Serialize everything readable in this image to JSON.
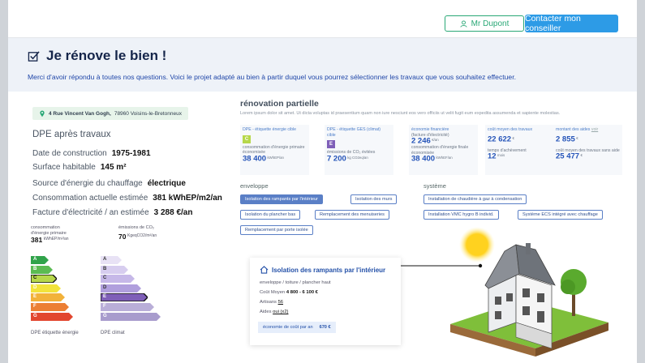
{
  "header": {
    "user_label": "Mr Dupont",
    "contact_label": "Contacter mon conseiller"
  },
  "banner": {
    "title": "Je rénove le bien !",
    "subtitle": "Merci d'avoir répondu à toutes nos questions. Voici le projet adapté au bien à partir duquel vous pourrez sélectionner les travaux que vous souhaitez effectuer."
  },
  "address": {
    "street": "4 Rue Vincent Van Gogh,",
    "city": "78960 Voisins-le-Bretonneux"
  },
  "dpe": {
    "title": "DPE après travaux",
    "construction_label": "Date de construction",
    "construction_value": "1975-1981",
    "surface_label": "Surface habitable",
    "surface_value": "145 m²",
    "energy_source_label": "Source d'énergie du chauffage",
    "energy_source_value": "électrique",
    "consumption_label": "Consommation actuelle estimée",
    "consumption_value": "381 kWhEP/m2/an",
    "bill_label": "Facture d'électricité / an estimée",
    "bill_value": "3 288 €/an",
    "primary_label_1": "consommation",
    "primary_label_2": "d'énergie primaire",
    "primary_value": "381",
    "primary_unit": "kWhEP/m²/an",
    "co2_label": "émissions de CO₂",
    "co2_value": "70",
    "co2_unit": "KgeqCO2/m²/an",
    "energy_scale_label": "DPE étiquette énergie",
    "climate_scale_label": "DPE climat",
    "energy_letters": [
      "A",
      "B",
      "C",
      "D",
      "E",
      "F",
      "G"
    ],
    "climate_letters": [
      "A",
      "B",
      "C",
      "D",
      "E",
      "F",
      "G"
    ],
    "energy_selected": "C",
    "climate_selected": "E",
    "colors": {
      "energy": [
        "#30a34a",
        "#5bbb52",
        "#b6d74a",
        "#f2e33b",
        "#f2b23a",
        "#ec7f34",
        "#e2462f"
      ],
      "climate": [
        "#e8e2f5",
        "#d7cdef",
        "#c6b8e8",
        "#b09fdd",
        "#7f5fb8",
        "#b9aed8",
        "#a89ccd"
      ]
    }
  },
  "renovation": {
    "title": "rénovation partielle",
    "subtitle": "Lorem ipsum dolor sit amet. Ut dicta voluptas id praesentium quam non iure nesciunt eos vero officiis ut velit fugit eum expedita assumenda et sapiente molestias.",
    "cards": [
      {
        "label": "DPE - étiquette énergie cible",
        "badge": "C",
        "badge_color": "#b6d74a",
        "line1": "consommation d'énergie primaire",
        "line2": "économisée",
        "value": "38 400",
        "unit": "kWhEP/an"
      },
      {
        "label": "DPE - étiquette GES (climat)",
        "label2": "cible",
        "badge": "E",
        "badge_color": "#7f5fb8",
        "line1": "émissions de CO₂ évitées",
        "value": "7 200",
        "unit": "kg CO2eq/an"
      },
      {
        "label": "économie financière",
        "label2": "(facture d'électricité)",
        "value_top": "2 246",
        "unit_top": "€/an",
        "line1": "consommation d'énergie finale",
        "line2": "économisée",
        "value": "38 400",
        "unit": "kWhEF/an"
      },
      {
        "label": "coût moyen des travaux",
        "value_top": "22 622",
        "unit_top": "€",
        "line1": "temps d'achèvement",
        "value": "12",
        "unit": "mois"
      },
      {
        "label": "montant des aides",
        "label_link": "voir",
        "value_top": "2 855",
        "unit_top": "€",
        "line1": "coût moyen des travaux sans aide",
        "value": "25 477",
        "unit": "€"
      }
    ],
    "envelope_label": "enveloppe",
    "system_label": "système",
    "envelope_tags": [
      "Isolation des rampants par l'intérieur",
      "Isolation des murs",
      "Isolation du plancher bas",
      "Remplacement des menuiseries",
      "Remplacement par porte isolée"
    ],
    "system_tags": [
      "Installation de chaudière à gaz à condensation",
      "Installation VMC hygro B individ.",
      "Système ECS intégré avec chauffage"
    ]
  },
  "detail": {
    "title": "Isolation des rampants par l'intérieur",
    "path": "enveloppe / toiture / plancher haut",
    "cost_label": "Coût Moyen",
    "cost_value": "4 800 - 6 100 €",
    "artisans_label": "Artisans",
    "artisans_value": "56",
    "aides_label": "Aides",
    "aides_value": "oui (x2)",
    "eco_label": "économie de coût par an",
    "eco_value": "670 €"
  }
}
